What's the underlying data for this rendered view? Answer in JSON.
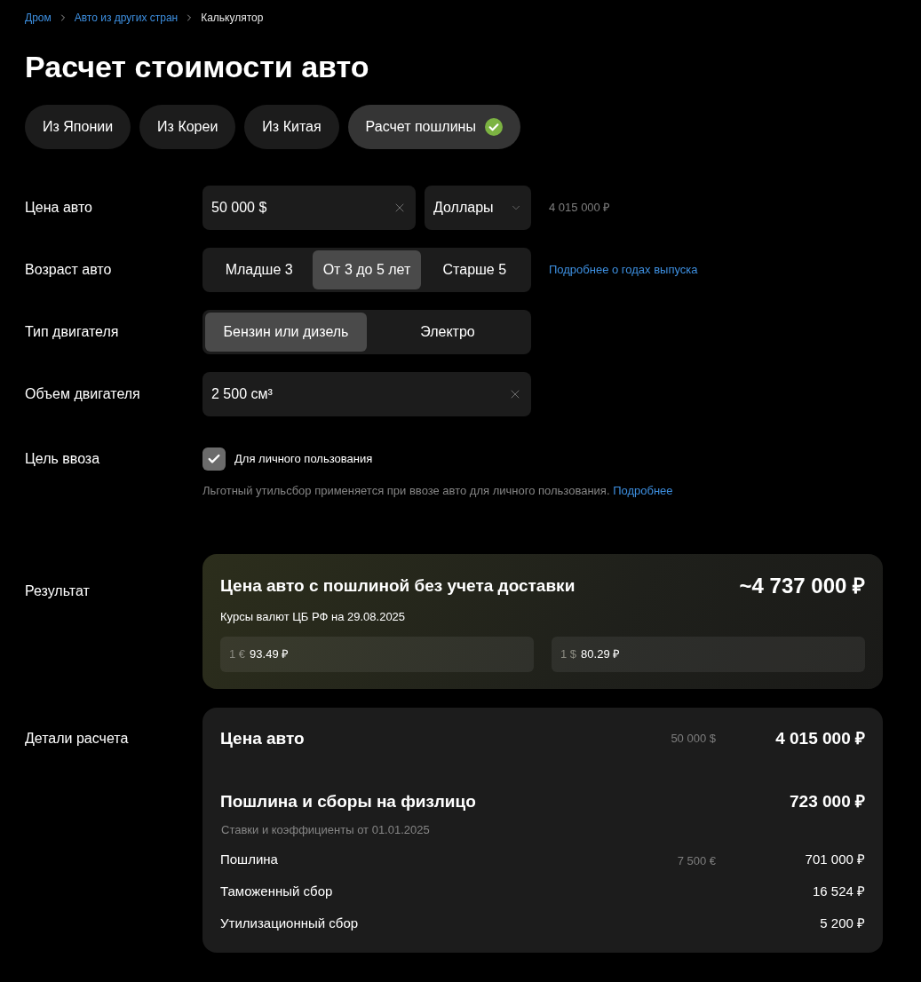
{
  "breadcrumbs": [
    {
      "label": "Дром",
      "kind": "link"
    },
    {
      "label": "Авто из других стран",
      "kind": "link"
    },
    {
      "label": "Калькулятор",
      "kind": "current"
    }
  ],
  "title": "Расчет стоимости авто",
  "tabs": [
    {
      "label": "Из Японии",
      "selected": false
    },
    {
      "label": "Из Кореи",
      "selected": false
    },
    {
      "label": "Из Китая",
      "selected": false
    },
    {
      "label": "Расчет пошлины",
      "selected": true
    }
  ],
  "form": {
    "rows": [
      {
        "kind": "price",
        "label": "Цена авто",
        "value": "50 000 $",
        "currency": "Доллары",
        "reading": "4 015 000 ₽"
      },
      {
        "kind": "segments",
        "label": "Возраст авто",
        "options": [
          {
            "label": "Младше 3",
            "selected": false
          },
          {
            "label": "От 3 до 5 лет",
            "selected": true
          },
          {
            "label": "Старше 5",
            "selected": false
          }
        ],
        "link": "Подробнее о годах выпуска"
      },
      {
        "kind": "segments",
        "label": "Тип двигателя",
        "options": [
          {
            "label": "Бензин или дизель",
            "selected": true
          },
          {
            "label": "Электро",
            "selected": false
          }
        ]
      },
      {
        "kind": "field",
        "label": "Объем двигателя",
        "value": "2 500 см³"
      },
      {
        "kind": "checkbox",
        "label": "Цель ввоза",
        "checkbox_label": "Для личного пользования",
        "checked": true,
        "hint": "Льготный утильсбор применяется при ввозе авто для личного пользования.",
        "hint_link": "Подробнее"
      }
    ]
  },
  "result": {
    "label": "Результат",
    "title": "Цена авто с пошлиной без учета доставки",
    "total": "~4 737 000 ₽",
    "rates_caption": "Курсы валют ЦБ РФ на 29.08.2025",
    "rates": [
      {
        "unit": "1 €",
        "value": "93.49 ₽"
      },
      {
        "unit": "1 $",
        "value": "80.29 ₽"
      }
    ]
  },
  "details": {
    "label": "Детали расчета",
    "sections": [
      {
        "title": "Цена авто",
        "secondary": "50 000 $",
        "amount": "4 015 000 ₽"
      },
      {
        "title": "Пошлина и сборы на физлицо",
        "amount": "723 000 ₽",
        "note": "Ставки и коэффициенты от 01.01.2025",
        "items": [
          {
            "label": "Пошлина",
            "secondary": "7 500 €",
            "amount": "701 000 ₽"
          },
          {
            "label": "Таможенный сбор",
            "amount": "16 524 ₽"
          },
          {
            "label": "Утилизационный сбор",
            "amount": "5 200 ₽"
          }
        ]
      }
    ]
  }
}
